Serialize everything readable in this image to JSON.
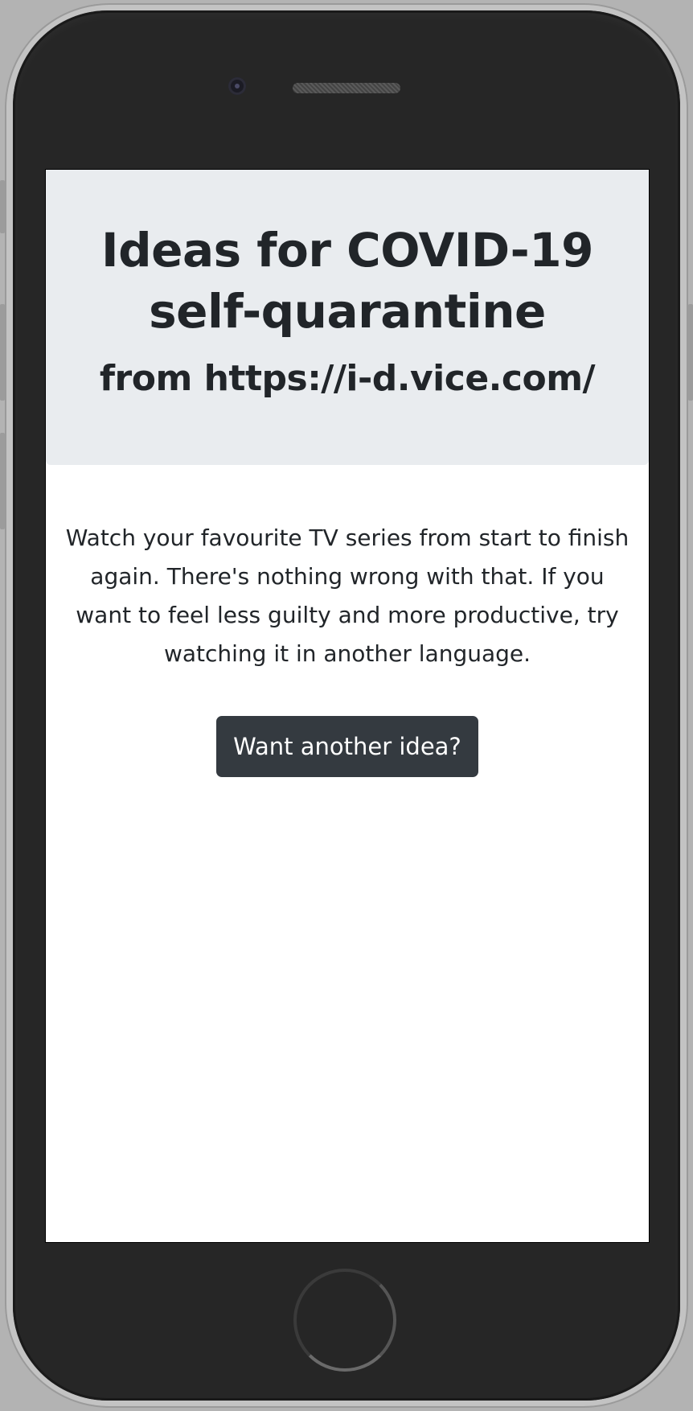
{
  "page": {
    "title_line1": "Ideas for COVID-19",
    "title_line2": "self-quarantine",
    "source": "from https://i-d.vice.com/",
    "idea": "Watch your favourite TV series from start to finish again. There's nothing wrong with that. If you want to feel less guilty and more productive, try watching it in another language.",
    "button_label": "Want another idea?"
  },
  "colors": {
    "jumbotron_bg": "#e9ecef",
    "text": "#212529",
    "button_bg": "#343a40",
    "button_text": "#ffffff",
    "device_body": "#262626"
  },
  "icons": {
    "camera": "front-camera-icon",
    "speaker": "speaker-grille-icon",
    "home": "home-button-icon"
  }
}
